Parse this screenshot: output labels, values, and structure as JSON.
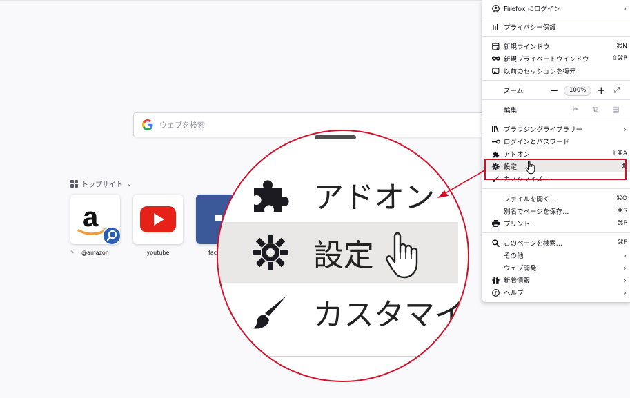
{
  "newtab": {
    "search": {
      "placeholder": "ウェブを検索"
    },
    "topsites": {
      "heading": "トップサイト",
      "tiles": [
        {
          "label": "@amazon"
        },
        {
          "label": "youtube"
        },
        {
          "label": "fac"
        }
      ]
    }
  },
  "menu": {
    "items": {
      "firefox_login": "Firefox にログイン",
      "privacy": "プライバシー保護",
      "new_window": {
        "label": "新規ウインドウ",
        "shortcut": "⌘N"
      },
      "new_private": {
        "label": "新規プライベートウインドウ",
        "shortcut": "⇧⌘P"
      },
      "restore": "以前のセッションを復元",
      "zoom": {
        "label": "ズーム",
        "minus": "−",
        "value": "100%",
        "plus": "+"
      },
      "edit": "編集",
      "library": "ブラウジングライブラリー",
      "logins": "ログインとパスワード",
      "addons": {
        "label": "アドオン",
        "shortcut": "⇧⌘A"
      },
      "settings": {
        "label": "設定",
        "shortcut": "⌘"
      },
      "customize": "カスタマイズ...",
      "open_file": {
        "label": "ファイルを開く...",
        "shortcut": "⌘O"
      },
      "save_as": {
        "label": "別名でページを保存...",
        "shortcut": "⌘S"
      },
      "print": {
        "label": "プリント...",
        "shortcut": "⌘P"
      },
      "find": {
        "label": "このページを検索...",
        "shortcut": "⌘F"
      },
      "more": "その他",
      "webdev": "ウェブ開発",
      "whatsnew": "新着情報",
      "help": "ヘルプ"
    }
  },
  "magnifier": {
    "addons": "アドオン",
    "settings": "設定",
    "customize": "カスタマイ"
  },
  "colors": {
    "annotation_red": "#d40f2a",
    "youtube_red": "#e62117",
    "facebook_blue": "#3b5998",
    "amazon_orange": "#f19e39"
  }
}
